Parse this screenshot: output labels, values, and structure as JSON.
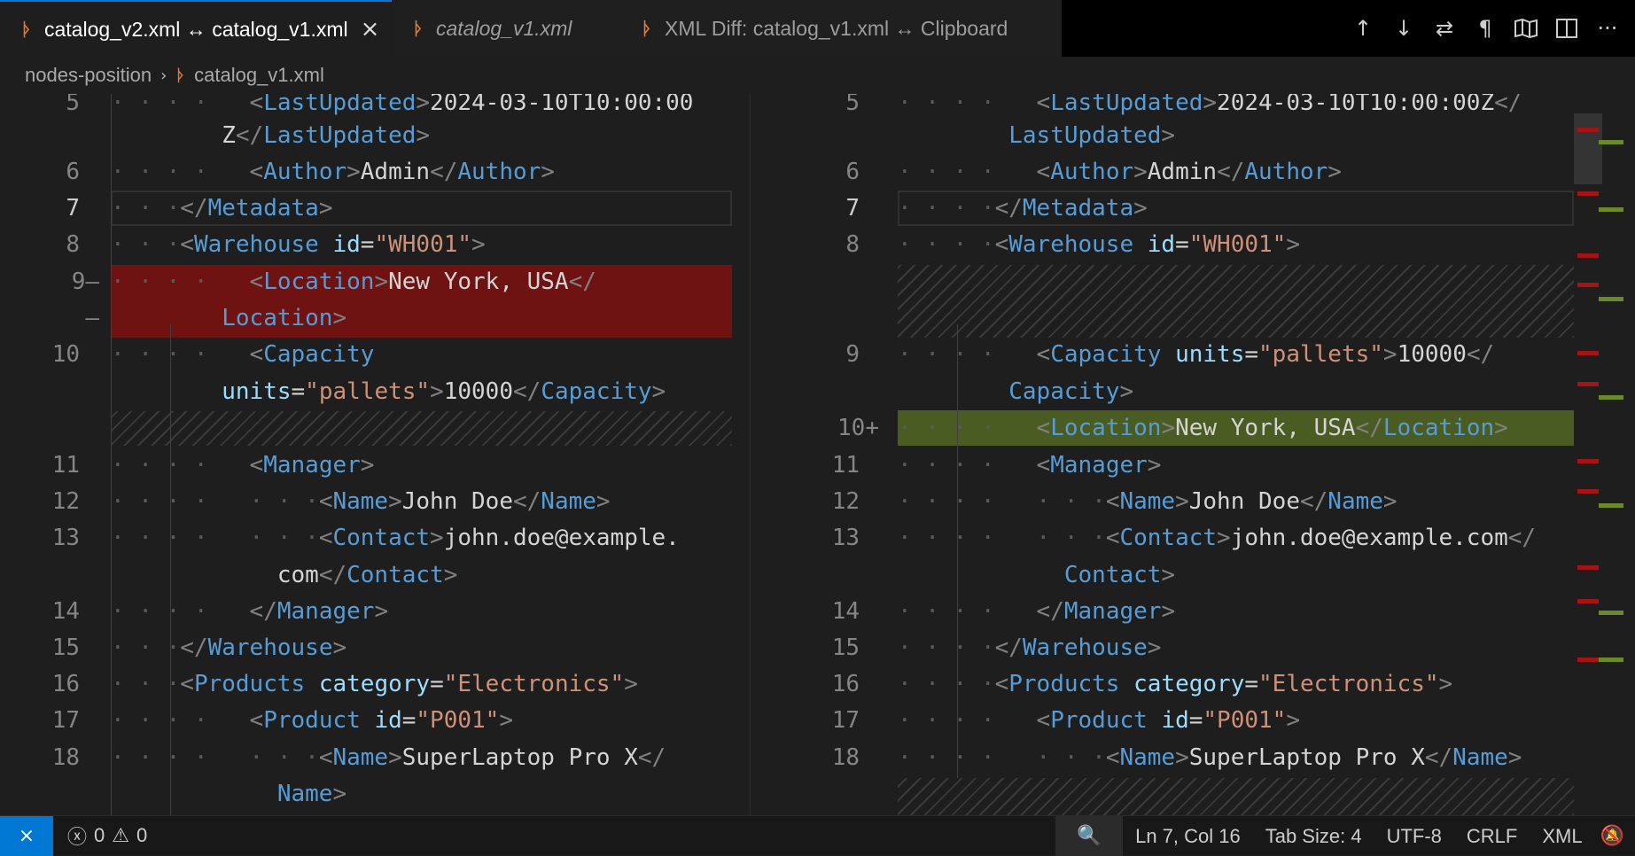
{
  "tabs": [
    {
      "title": "catalog_v2.xml ↔ catalog_v1.xml",
      "active": true,
      "close": "×"
    },
    {
      "title": "catalog_v1.xml",
      "italic": true
    },
    {
      "title": "XML Diff: catalog_v1.xml ↔ Clipboard"
    }
  ],
  "toolbar_icons": [
    "arrow-up-icon",
    "arrow-down-icon",
    "swap-icon",
    "pilcrow-icon",
    "map-icon",
    "split-editor-icon",
    "more-actions-icon"
  ],
  "toolbar": {
    "up": "↑",
    "down": "↓",
    "swap": "⇄",
    "pilcrow": "¶",
    "map": "🕮",
    "split": "◫",
    "more": "···"
  },
  "breadcrumb": {
    "folder": "nodes-position",
    "file": "catalog_v1.xml",
    "icon": "rss-icon"
  },
  "left_lines": [
    {
      "num": "5"
    },
    {
      "num": ""
    },
    {
      "num": "6"
    },
    {
      "num": "7",
      "cur": true
    },
    {
      "num": "8"
    },
    {
      "num": "9—"
    },
    {
      "num": "—"
    },
    {
      "num": "10"
    },
    {
      "num": ""
    },
    {
      "num": ""
    },
    {
      "num": "11"
    },
    {
      "num": "12"
    },
    {
      "num": "13"
    },
    {
      "num": ""
    },
    {
      "num": "14"
    },
    {
      "num": "15"
    },
    {
      "num": "16"
    },
    {
      "num": "17"
    },
    {
      "num": "18"
    },
    {
      "num": ""
    }
  ],
  "right_lines": [
    {
      "num": "5"
    },
    {
      "num": ""
    },
    {
      "num": "6"
    },
    {
      "num": "7",
      "cur": true
    },
    {
      "num": "8"
    },
    {
      "num": ""
    },
    {
      "num": ""
    },
    {
      "num": "9"
    },
    {
      "num": ""
    },
    {
      "num": "10+"
    },
    {
      "num": "11"
    },
    {
      "num": "12"
    },
    {
      "num": "13"
    },
    {
      "num": ""
    },
    {
      "num": "14"
    },
    {
      "num": "15"
    },
    {
      "num": "16"
    },
    {
      "num": "17"
    },
    {
      "num": "18"
    },
    {
      "num": ""
    }
  ],
  "status": {
    "errors": "0",
    "warnings": "0",
    "position": "Ln 7, Col 16",
    "tab_size": "Tab Size: 4",
    "encoding": "UTF-8",
    "eol": "CRLF",
    "language": "XML"
  },
  "colors": {
    "deleted": "#6e1212",
    "inserted": "#4b5c23",
    "accent": "#0078d4"
  }
}
